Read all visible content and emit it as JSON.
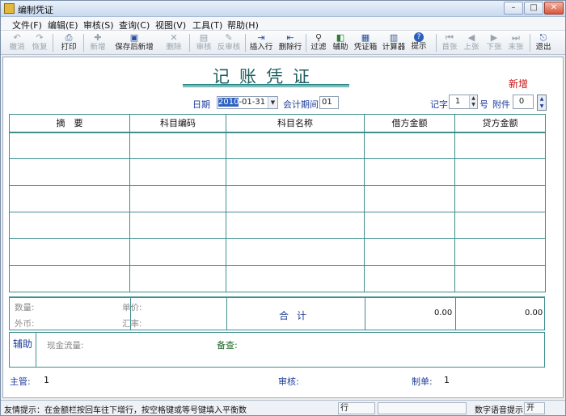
{
  "window": {
    "title": "编制凭证"
  },
  "menu": [
    "文件(F)",
    "编辑(E)",
    "审核(S)",
    "查询(C)",
    "视图(V)",
    "工具(T)",
    "帮助(H)"
  ],
  "toolbar": [
    {
      "label": "撤消",
      "icon": "undo-icon",
      "glyph": "↶",
      "enabled": false
    },
    {
      "label": "恢复",
      "icon": "redo-icon",
      "glyph": "↷",
      "enabled": false
    },
    {
      "label": "打印",
      "icon": "printer-icon",
      "glyph": "⎙",
      "enabled": true
    },
    {
      "label": "新增",
      "icon": "add-icon",
      "glyph": "✚",
      "enabled": false
    },
    {
      "label": "保存后新增",
      "icon": "save-icon",
      "glyph": "▣",
      "enabled": true
    },
    {
      "label": "删除",
      "icon": "delete-icon",
      "glyph": "✕",
      "enabled": false
    },
    {
      "label": "审核",
      "icon": "audit-icon",
      "glyph": "▤",
      "enabled": false
    },
    {
      "label": "反审核",
      "icon": "unaudit-icon",
      "glyph": "✎",
      "enabled": false
    },
    {
      "label": "插入行",
      "icon": "insert-row-icon",
      "glyph": "⇥",
      "enabled": true
    },
    {
      "label": "删除行",
      "icon": "delete-row-icon",
      "glyph": "⇤",
      "enabled": true
    },
    {
      "label": "过滤",
      "icon": "filter-icon",
      "glyph": "⚲",
      "enabled": true
    },
    {
      "label": "辅助",
      "icon": "assist-icon",
      "glyph": "◧",
      "enabled": true
    },
    {
      "label": "凭证箱",
      "icon": "voucher-box-icon",
      "glyph": "▦",
      "enabled": true
    },
    {
      "label": "计算器",
      "icon": "calculator-icon",
      "glyph": "▥",
      "enabled": true
    },
    {
      "label": "提示",
      "icon": "help-icon",
      "glyph": "?",
      "enabled": true
    },
    {
      "label": "首张",
      "icon": "first-icon",
      "glyph": "⏮",
      "enabled": false
    },
    {
      "label": "上张",
      "icon": "previous-icon",
      "glyph": "◀",
      "enabled": false
    },
    {
      "label": "下张",
      "icon": "next-icon",
      "glyph": "▶",
      "enabled": false
    },
    {
      "label": "末张",
      "icon": "last-icon",
      "glyph": "⏭",
      "enabled": false
    },
    {
      "label": "退出",
      "icon": "exit-icon",
      "glyph": "⎋",
      "enabled": true
    }
  ],
  "voucher": {
    "title": "记账凭证",
    "status": "新增",
    "date_label": "日期",
    "date_year_highlight": "2010",
    "date_rest": "-01-31",
    "period_label": "会计期间",
    "period_value": "01",
    "word_label": "记字",
    "number_value": "1",
    "number_suffix": "号",
    "attach_label": "附件",
    "attach_value": "0",
    "columns": [
      "摘　要",
      "科目编码",
      "科目名称",
      "借方金额",
      "贷方金额"
    ],
    "rows": [
      [
        "",
        "",
        "",
        "",
        ""
      ],
      [
        "",
        "",
        "",
        "",
        ""
      ],
      [
        "",
        "",
        "",
        "",
        ""
      ],
      [
        "",
        "",
        "",
        "",
        ""
      ],
      [
        "",
        "",
        "",
        "",
        ""
      ],
      [
        "",
        "",
        "",
        "",
        ""
      ]
    ],
    "qty_label": "数量:",
    "unit_price_label": "单价:",
    "currency_label": "外币:",
    "rate_label": "汇率:",
    "total_label": "合计",
    "debit_total": "0.00",
    "credit_total": "0.00",
    "aux_label": "辅助",
    "cash_flow_label": "现金流量:",
    "remark_label": "备查:",
    "supervisor_label": "主管:",
    "supervisor_value": "1",
    "auditor_label": "审核:",
    "auditor_value": "",
    "maker_label": "制单:",
    "maker_value": "1"
  },
  "statusbar": {
    "tip": "友情提示：在金额栏按回车往下增行，按空格键或等号键填入平衡数",
    "row_label": "行",
    "voice_label": "数字语音提示",
    "voice_state": "开"
  }
}
